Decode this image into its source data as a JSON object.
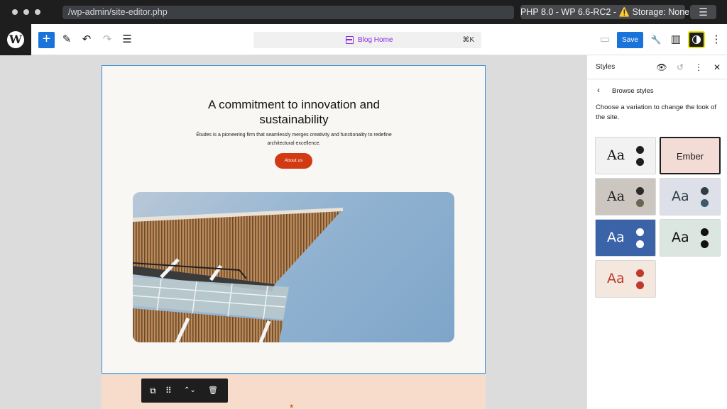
{
  "browser": {
    "url": "/wp-admin/site-editor.php",
    "environment": "PHP 8.0 - WP 6.6-RC2 - ⚠️ Storage: None",
    "menu_icon": "☰"
  },
  "toolbar": {
    "logo": "W",
    "add_icon": "+",
    "edit_icon": "✎",
    "undo_icon": "↶",
    "redo_icon": "↷",
    "list_view_icon": "☰",
    "command_title": "Blog Home",
    "command_shortcut": "⌘K",
    "device_icon": "▭",
    "save_label": "Save",
    "tools_icon": "🔧",
    "settings_icon": "▥",
    "more_icon": "⋮"
  },
  "canvas": {
    "hero_title": "A commitment to innovation and sustainability",
    "hero_subtitle": "Études is a pioneering firm that seamlessly merges creativity and functionality to redefine architectural excellence.",
    "cta_label": "About us",
    "footer_mark": "*",
    "block_toolbar": {
      "duplicate_icon": "⧉",
      "drag_icon": "⠿",
      "move_icon": "⌃⌄",
      "delete_icon": "🗑"
    }
  },
  "sidebar": {
    "title": "Styles",
    "eye_icon": "👁",
    "revisions_icon": "↺",
    "more_icon": "⋮",
    "close_icon": "✕",
    "back_icon": "‹",
    "subtitle": "Browse styles",
    "description": "Choose a variation to change the look of the site.",
    "variations": [
      {
        "label": "Aa",
        "bg": "#f2f2f2",
        "text": "#111111",
        "dot1": "#1e1e1e",
        "dot2": "#1e1e1e",
        "font": "serif"
      },
      {
        "label": "Ember",
        "bg": "#f2dcd5",
        "text": "#1e1e1e",
        "selected": true
      },
      {
        "label": "Aa",
        "bg": "#cbc6bf",
        "text": "#222222",
        "dot1": "#2b2b2b",
        "dot2": "#6b6354",
        "font": "serif"
      },
      {
        "label": "Aa",
        "bg": "#dde0e8",
        "text": "#2f3e46",
        "dot1": "#2f3e46",
        "dot2": "#3d5a6c",
        "font": "sans"
      },
      {
        "label": "Aa",
        "bg": "#3b63a8",
        "text": "#ffffff",
        "dot1": "#ffffff",
        "dot2": "#ffffff",
        "font": "sans"
      },
      {
        "label": "Aa",
        "bg": "#dbe6e0",
        "text": "#111111",
        "dot1": "#111111",
        "dot2": "#111111",
        "font": "sans"
      },
      {
        "label": "Aa",
        "bg": "#f3e7de",
        "text": "#c0392b",
        "dot1": "#c0392b",
        "dot2": "#c0392b",
        "font": "sans"
      }
    ]
  }
}
